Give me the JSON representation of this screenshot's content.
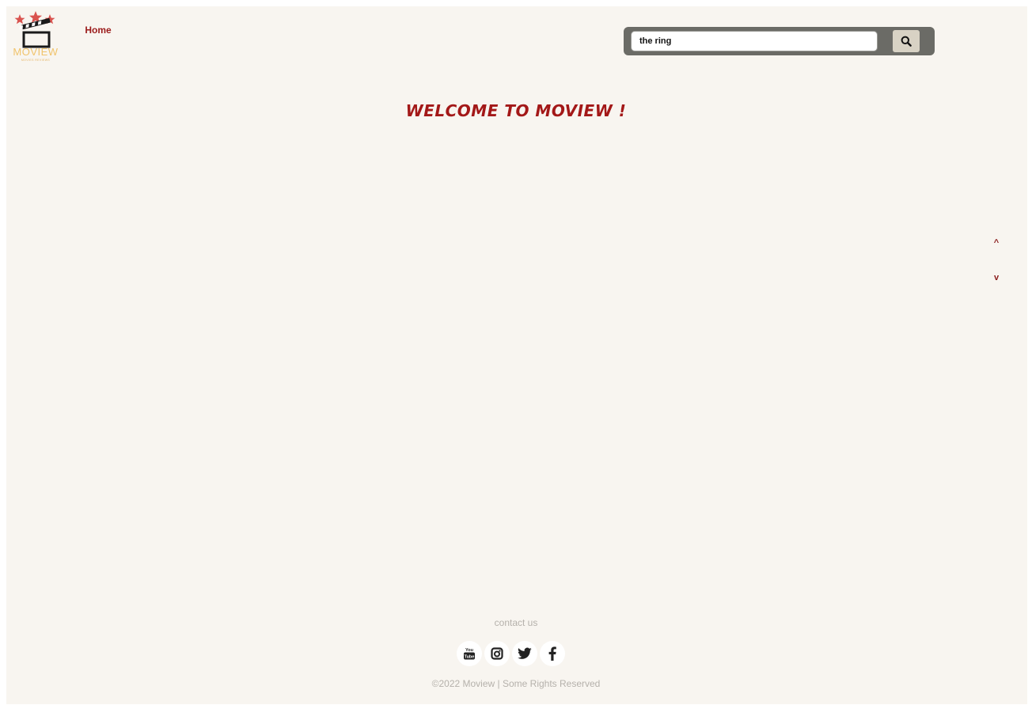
{
  "header": {
    "logo": {
      "title": "MOVIEW",
      "subtitle": "MOVIES REVIEWS",
      "icon": "clapperboard-stars-icon",
      "colors": {
        "stars": "#d9534f",
        "title": "#f0c36b"
      }
    },
    "nav": {
      "home_label": "Home"
    },
    "search": {
      "value": "the ring",
      "icon": "search-icon"
    }
  },
  "main": {
    "welcome": "WELCOME TO MOVIEW !",
    "scroll_up_label": "^",
    "scroll_down_label": "v"
  },
  "footer": {
    "contact_label": "contact us",
    "socials": [
      {
        "name": "youtube",
        "icon": "youtube-icon"
      },
      {
        "name": "instagram",
        "icon": "instagram-icon"
      },
      {
        "name": "twitter",
        "icon": "twitter-icon"
      },
      {
        "name": "facebook",
        "icon": "facebook-icon"
      }
    ],
    "copyright": "©2022 Moview | Some Rights Reserved"
  },
  "colors": {
    "accent": "#a31818",
    "background": "#f8f5f0",
    "search_frame": "#6b6b66",
    "search_button": "#d8d2c4"
  }
}
